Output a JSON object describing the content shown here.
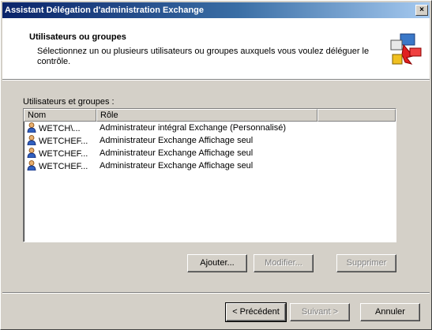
{
  "window": {
    "title": "Assistant Délégation d'administration Exchange",
    "close_glyph": "×"
  },
  "header": {
    "title": "Utilisateurs ou groupes",
    "description": "Sélectionnez un ou plusieurs utilisateurs ou groupes auxquels vous voulez déléguer le contrôle.",
    "icon": "delegation-wizard-icon"
  },
  "list": {
    "label": "Utilisateurs et groupes :",
    "columns": [
      "Nom",
      "Rôle"
    ],
    "rows": [
      {
        "name": "WETCH\\...",
        "role": "Administrateur intégral Exchange (Personnalisé)",
        "icon": "user-icon"
      },
      {
        "name": "WETCHEF...",
        "role": "Administrateur Exchange Affichage seul",
        "icon": "user-icon"
      },
      {
        "name": "WETCHEF...",
        "role": "Administrateur Exchange Affichage seul",
        "icon": "user-icon"
      },
      {
        "name": "WETCHEF...",
        "role": "Administrateur Exchange Affichage seul",
        "icon": "user-icon"
      }
    ]
  },
  "actions": {
    "add": "Ajouter...",
    "edit": "Modifier...",
    "remove": "Supprimer"
  },
  "nav": {
    "back": "< Précédent",
    "next": "Suivant >",
    "cancel": "Annuler"
  }
}
